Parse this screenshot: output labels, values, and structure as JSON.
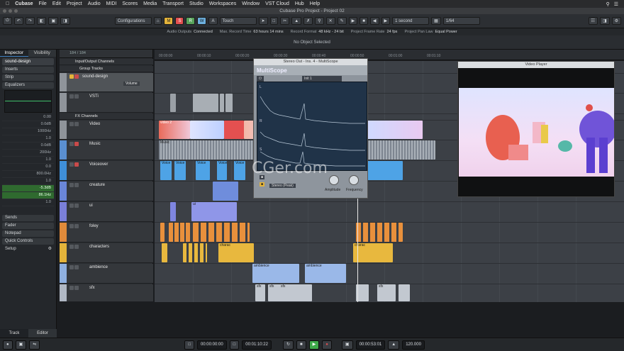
{
  "menubar": {
    "apple_icon": "apple-icon",
    "app_name": "Cubase",
    "items": [
      "File",
      "Edit",
      "Project",
      "Audio",
      "MIDI",
      "Scores",
      "Media",
      "Transport",
      "Studio",
      "Workspaces",
      "Window",
      "VST Cloud",
      "Hub",
      "Help"
    ]
  },
  "window": {
    "title": "Cubase Pro Project - Project 02"
  },
  "toolbar": {
    "configurations_label": "Configurations",
    "automation_mode": "Touch",
    "m_label": "M",
    "s_label": "S",
    "r_label": "R",
    "w_label": "W",
    "a_label": "A",
    "nudge_label": "1 second",
    "quantize_label": "1/64",
    "colors": {
      "mute": "#e3b33a",
      "solo": "#e25050",
      "read": "#57a35a",
      "write": "#6db0de"
    }
  },
  "infoline": {
    "audio_outputs_label": "Audio Outputs",
    "audio_outputs_value": "Connected",
    "record_time_label": "Max. Record Time",
    "record_time_value": "63 hours 14 mins",
    "record_format_label": "Record Format",
    "record_format_value": "48 kHz - 24 bit",
    "frame_rate_label": "Project Frame Rate",
    "frame_rate_value": "24 fps",
    "pan_law_label": "Project Pan Law",
    "pan_law_value": "Equal Power"
  },
  "eventline": {
    "text": "No Object Selected"
  },
  "inspector": {
    "tab_inspector": "Inspector",
    "tab_visibility": "Visibility",
    "track_name": "sound-design",
    "sections": [
      "Inserts",
      "Strip",
      "Equalizers"
    ],
    "values": [
      "0.00",
      "0.0dB",
      "1000Hz",
      "1.0",
      "0.0dB",
      "200Hz",
      "1.0",
      "0.0",
      "800.0Hz",
      "1.0",
      "-5.3dB",
      "86.1Hz",
      "1.0"
    ],
    "bottom_sections": [
      "Sends",
      "Fader",
      "Notepad",
      "Quick Controls"
    ],
    "setup_label": "Setup",
    "tab_track": "Track",
    "tab_editor": "Editor"
  },
  "tracklist": {
    "header": "184 / 184",
    "folders": [
      "Input/Output Channels",
      "Group Tracks",
      "FX Channels"
    ],
    "tracks": [
      {
        "name": "sound-design",
        "color": "#8f949a"
      },
      {
        "name": "VSTi",
        "color": "#8f949a"
      },
      {
        "name": "Video",
        "color": "#8f949a"
      },
      {
        "name": "Music",
        "color": "#5a8fd0"
      },
      {
        "name": "Voiceover",
        "color": "#3f8fd8"
      },
      {
        "name": "creature",
        "color": "#6a86d8"
      },
      {
        "name": "ui",
        "color": "#7a7fd8"
      },
      {
        "name": "foley",
        "color": "#e08a3a"
      },
      {
        "name": "characters",
        "color": "#e3b33a"
      },
      {
        "name": "ambience",
        "color": "#8fb0e0"
      },
      {
        "name": "sfx",
        "color": "#b0b8c4"
      }
    ],
    "volume_label": "Volume"
  },
  "ruler": {
    "ticks": [
      "00:00:00",
      "00:00:10",
      "00:00:20",
      "00:00:30",
      "00:00:40",
      "00:00:50",
      "00:01:00",
      "00:01:10"
    ]
  },
  "clips": {
    "video_label": "video 2",
    "music_label": "Music",
    "voice_label": "Voice",
    "ui_label": "ui",
    "char_label": "charac",
    "ambience_label": "ambience",
    "sfx_label": "sfx"
  },
  "multiscope": {
    "window_title": "Stereo Out - Ins. 4 - MultiScope",
    "brand": "MultiScope",
    "preset": "Init 1",
    "l_label": "L",
    "r_label": "R",
    "s_label": "S",
    "mode_label": "Stereo (Peak)",
    "amplitude_label": "Amplitude",
    "frequency_label": "Frequency"
  },
  "video_player": {
    "title": "Video Player"
  },
  "watermark": "CGer.com",
  "transport": {
    "left_locator": "00:00:00:00",
    "right_locator": "00:01:10:22",
    "position": "00:00:53:01",
    "tempo": "120.000"
  }
}
